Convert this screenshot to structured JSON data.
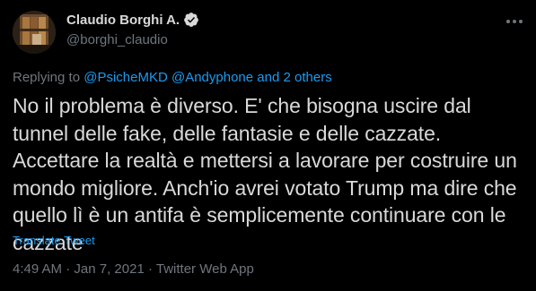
{
  "author": {
    "display_name": "Claudio Borghi A.",
    "handle": "@borghi_claudio",
    "verified_icon": "verified-badge-icon"
  },
  "reply": {
    "prefix": "Replying to",
    "mention1": "@PsicheMKD",
    "mention2": "@Andyphone",
    "others": "and 2 others"
  },
  "tweet_text": "No il problema è diverso. E' che bisogna uscire dal tunnel delle fake, delle fantasie e delle cazzate. Accettare la realtà e mettersi a lavorare per costruire un mondo migliore. Anch'io avrei votato Trump ma dire che quello lì è un antifa è semplicemente continuare con le cazzate",
  "translate_label": "Translate Tweet",
  "meta": {
    "time": "4:49 AM",
    "separator": "·",
    "date": "Jan 7, 2021",
    "source": "Twitter Web App"
  },
  "colors": {
    "background": "#000000",
    "text": "#d9d9d9",
    "secondary": "#6e767d",
    "accent": "#1d9bf0"
  }
}
